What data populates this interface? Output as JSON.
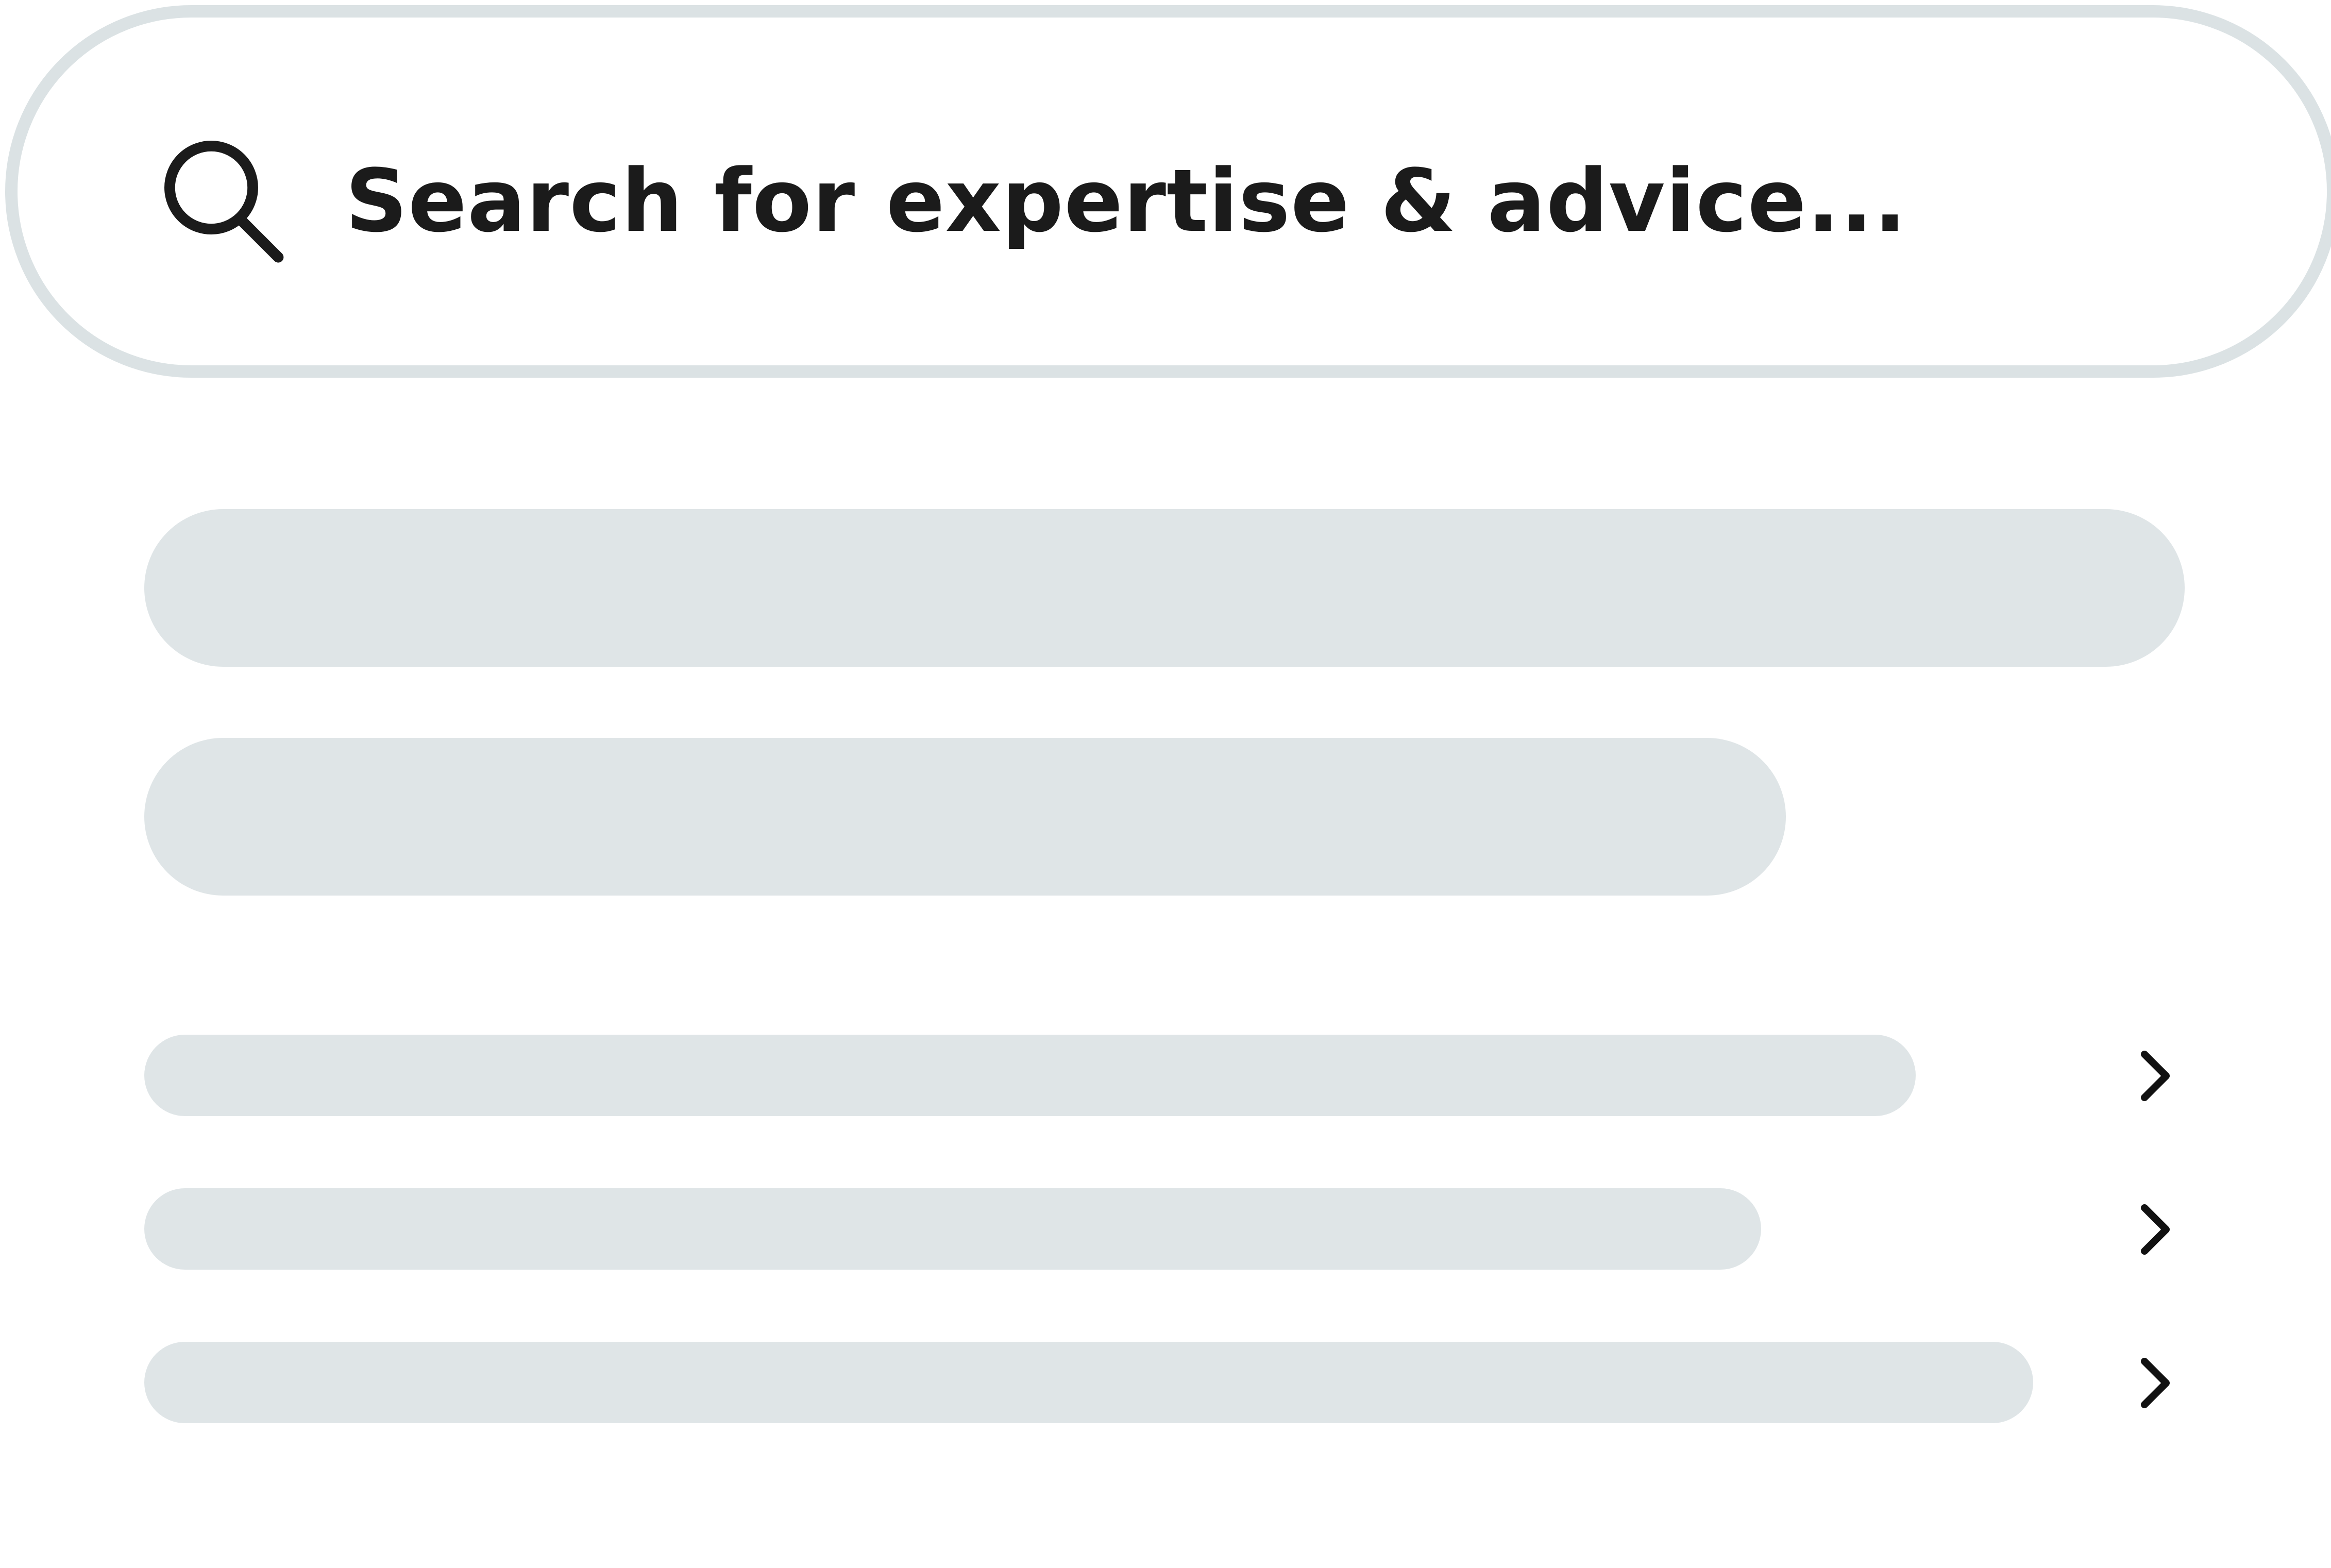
{
  "search": {
    "placeholder": "Search for expertise & advice...",
    "icon": "search-icon"
  },
  "colors": {
    "border": "#dbe2e4",
    "skeleton": "#dfe5e7",
    "text": "#1b1b1b"
  },
  "results": {
    "row_icon": "chevron-right-icon"
  }
}
